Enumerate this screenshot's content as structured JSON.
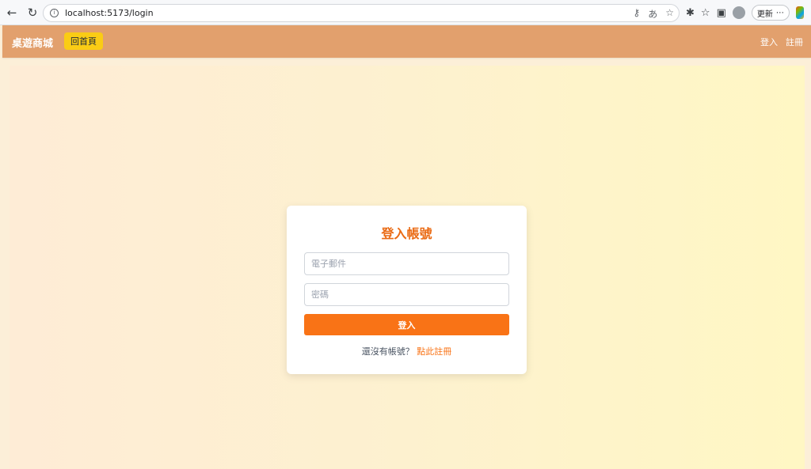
{
  "browser": {
    "url": "localhost:5173/login",
    "update_label": "更新"
  },
  "header": {
    "brand": "桌遊商城",
    "home_button": "回首頁",
    "login_link": "登入",
    "register_link": "註冊"
  },
  "login_card": {
    "title": "登入帳號",
    "email_placeholder": "電子郵件",
    "password_placeholder": "密碼",
    "submit_label": "登入",
    "no_account_text": "還沒有帳號？",
    "register_link": "點此註冊"
  },
  "colors": {
    "header_bg": "#e2a06d",
    "accent": "#f97316",
    "title": "#ea6a13",
    "home_button_bg": "#facc15"
  }
}
